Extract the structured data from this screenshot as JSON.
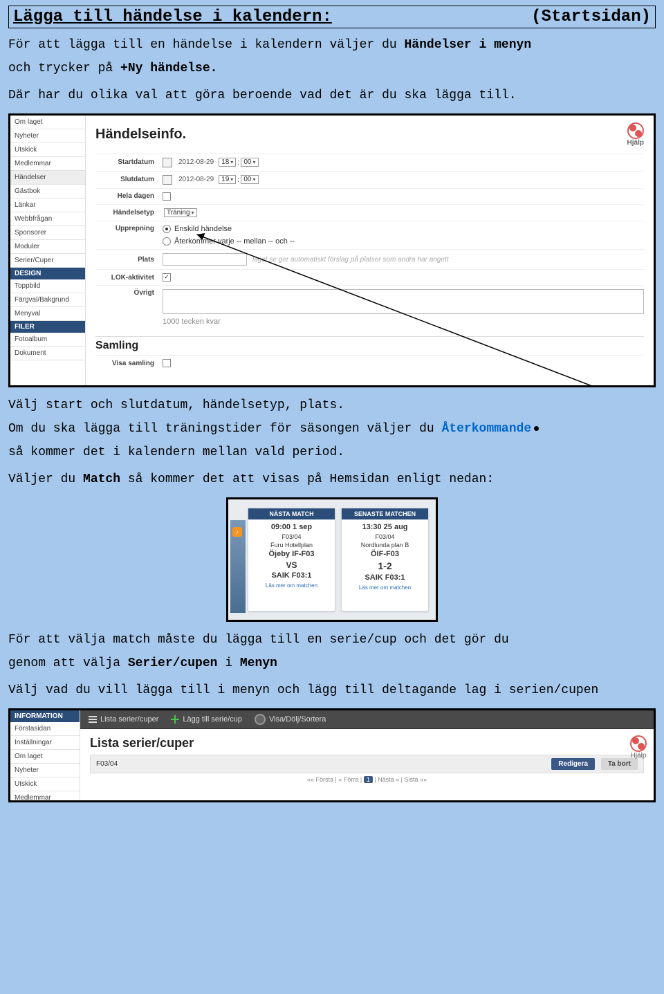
{
  "header": {
    "title_left": "Lägga till händelse i kalendern:",
    "title_right": "(Startsidan)"
  },
  "intro": {
    "p1_a": "För att lägga till en händelse i kalendern väljer du ",
    "p1_b": "Händelser i menyn",
    "p2_a": "och trycker på ",
    "p2_b": "+Ny händelse.",
    "p3": "Där har du olika val att göra beroende vad det är du ska lägga till."
  },
  "shot1": {
    "title": "Händelseinfo.",
    "help": "Hjälp",
    "sidebar": {
      "items": [
        "Om laget",
        "Nyheter",
        "Utskick",
        "Medlemmar",
        "Händelser",
        "Gästbok",
        "Länkar",
        "Webbfrågan",
        "Sponsorer",
        "Moduler",
        "Serier/Cuper"
      ],
      "design_header": "DESIGN",
      "design_items": [
        "Toppbild",
        "Färgval/Bakgrund",
        "Menyval"
      ],
      "filer_header": "FILER",
      "filer_items": [
        "Fotoalbum",
        "Dokument"
      ]
    },
    "labels": {
      "startdatum": "Startdatum",
      "slutdatum": "Slutdatum",
      "heladagen": "Hela dagen",
      "handelsetyp": "Händelsetyp",
      "upprepning": "Upprepning",
      "plats": "Plats",
      "lok": "LOK-aktivitet",
      "ovrigt": "Övrigt",
      "samling": "Samling",
      "visasamling": "Visa samling"
    },
    "values": {
      "startdate": "2012-08-29",
      "starthour": "18",
      "sep": ":",
      "startmin": "00",
      "enddate": "2012-08-29",
      "endhour": "19",
      "endmin": "00",
      "handelsetyp": "Träning",
      "upprepning_single": "Enskild händelse",
      "upprepning_recur": "Återkommer varje -- mellan -- och --",
      "plats_hint": "laget.se ger automatiskt förslag på platser som andra har angett",
      "chars_left": "1000 tecken kvar"
    }
  },
  "mid": {
    "p1": "Välj start och slutdatum, händelsetyp, plats.",
    "p2_a": "Om du ska lägga till träningstider för säsongen väljer du ",
    "p2_b": "Återkommande",
    "p3": "så kommer det i kalendern mellan vald period.",
    "p4_a": "Väljer du ",
    "p4_b": "Match",
    "p4_c": " så kommer det att visas på Hemsidan enligt nedan:"
  },
  "shot2": {
    "left": {
      "head": "NÄSTA MATCH",
      "time": "09:00 1 sep",
      "team": "F03/04",
      "venue": "Furu Hotellplan",
      "t1": "Öjeby IF-F03",
      "vs": "VS",
      "t2": "SAIK F03:1",
      "link": "Läs mer om matchen"
    },
    "right": {
      "head": "SENASTE MATCHEN",
      "time": "13:30 25 aug",
      "team": "F03/04",
      "venue": "Nordlunda plan B",
      "t1": "ÖIF-F03",
      "score": "1-2",
      "t2": "SAIK F03:1",
      "link": "Läs mer om matchen"
    }
  },
  "below": {
    "p1": "För att välja match måste du lägga till en serie/cup och det gör du",
    "p2_a": "genom att välja ",
    "p2_b": "Serier/cupen",
    "p2_c": " i ",
    "p2_d": "Menyn",
    "p3": "Välj vad du vill lägga till i menyn och lägg till deltagande lag i serien/cupen"
  },
  "shot3": {
    "sidebar_header": "INFORMATION",
    "sidebar_items": [
      "Förstasidan",
      "Inställningar",
      "Om laget",
      "Nyheter",
      "Utskick",
      "Medlemmar"
    ],
    "toolbar": {
      "list": "Lista serier/cuper",
      "add": "Lägg till serie/cup",
      "sort": "Visa/Dölj/Sortera"
    },
    "title": "Lista serier/cuper",
    "help": "Hjälp",
    "row_label": "F03/04",
    "btn_edit": "Redigera",
    "btn_del": "Ta bort",
    "pager": {
      "first": "«« Första",
      "prev": "« Förra",
      "cur": "1",
      "next": "Nästa »",
      "last": "Sista »»",
      "sep": " | "
    }
  }
}
